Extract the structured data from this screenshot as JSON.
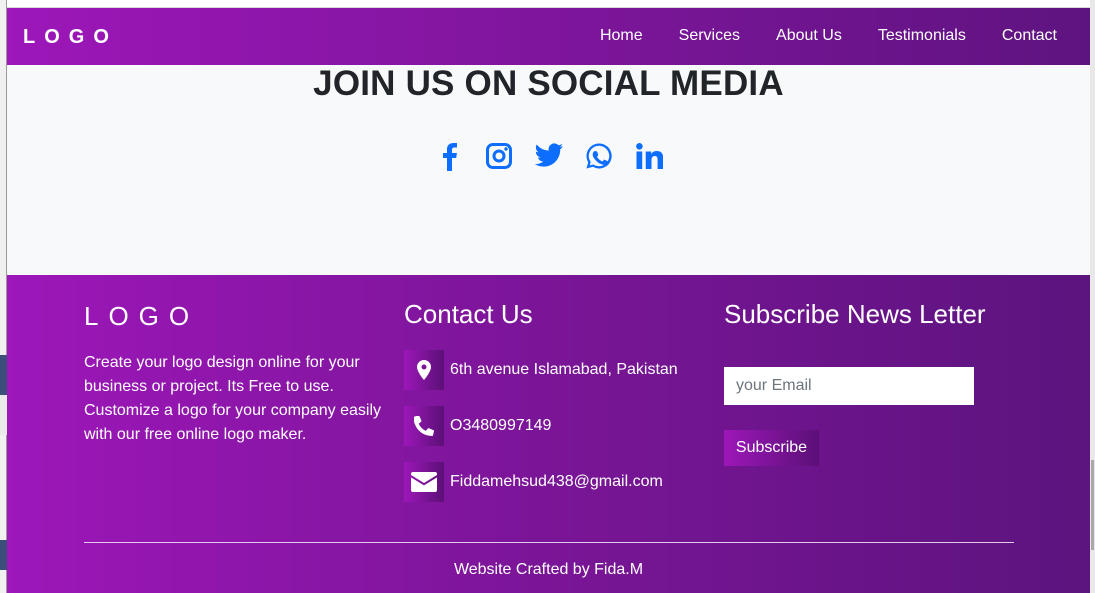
{
  "navbar": {
    "logo": "LOGO",
    "links": [
      "Home",
      "Services",
      "About Us",
      "Testimonials",
      "Contact"
    ]
  },
  "social": {
    "title": "JOIN US ON SOCIAL MEDIA",
    "icons": [
      "facebook-icon",
      "instagram-icon",
      "twitter-icon",
      "whatsapp-icon",
      "linkedin-icon"
    ],
    "icon_color": "#0d6efd"
  },
  "footer": {
    "logo": "LOGO",
    "description": "Create your logo design online for your business or project. Its Free to use. Customize a logo for your company easily with our free online logo maker.",
    "contact_heading": "Contact Us",
    "contact": {
      "address": "6th avenue Islamabad, Pakistan",
      "phone": "O3480997149",
      "email": "Fiddamehsud438@gmail.com"
    },
    "newsletter_heading": "Subscribe News Letter",
    "email_placeholder": "your Email",
    "subscribe_label": "Subscribe",
    "credit": "Website Crafted by Fida.M"
  },
  "colors": {
    "gradient_start": "#9d17b9",
    "gradient_end": "#5c147e",
    "page_bg": "#f8f9fa",
    "heading_text": "#212529"
  }
}
